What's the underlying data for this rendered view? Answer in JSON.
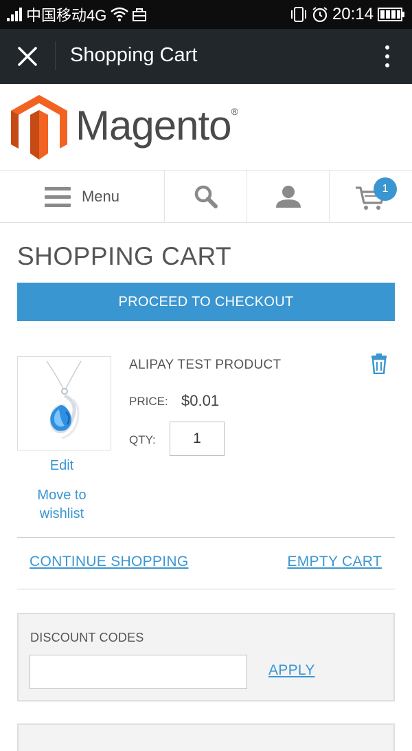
{
  "status_bar": {
    "carrier": "中国移动4G",
    "time": "20:14"
  },
  "app_bar": {
    "title": "Shopping Cart",
    "close_icon": "close-icon",
    "menu_icon": "more-vert-icon",
    "background": "#21272b"
  },
  "brand": {
    "name": "Magento",
    "registered": "®",
    "logo_color": "#f26322"
  },
  "nav": {
    "menu_label": "Menu",
    "cart_count": "1",
    "icons": [
      "hamburger-icon",
      "search-icon",
      "account-icon",
      "cart-icon"
    ]
  },
  "cart": {
    "title": "SHOPPING CART",
    "checkout_button": "PROCEED TO CHECKOUT",
    "accent_color": "#3a96d1",
    "item": {
      "name": "ALIPAY TEST PRODUCT",
      "price_label": "PRICE:",
      "price": "$0.01",
      "qty_label": "QTY:",
      "qty": "1",
      "edit_link": "Edit",
      "wishlist_link": "Move to wishlist",
      "delete_icon": "trash-icon"
    },
    "continue_link": "CONTINUE SHOPPING",
    "empty_link": "EMPTY CART"
  },
  "discount": {
    "title": "DISCOUNT CODES",
    "input_value": "",
    "apply_link": "APPLY"
  }
}
